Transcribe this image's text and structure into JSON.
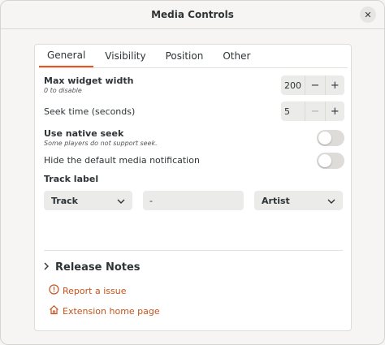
{
  "window": {
    "title": "Media Controls"
  },
  "tabs": [
    {
      "label": "General",
      "active": true
    },
    {
      "label": "Visibility"
    },
    {
      "label": "Position"
    },
    {
      "label": "Other"
    }
  ],
  "settings": {
    "max_widget_width": {
      "label": "Max widget width",
      "subtitle": "0 to disable",
      "value": "200",
      "minus": "−",
      "plus": "+"
    },
    "seek_time": {
      "label": "Seek time (seconds)",
      "value": "5",
      "minus": "−",
      "plus": "+"
    },
    "native_seek": {
      "label": "Use native seek",
      "subtitle": "Some players do not support seek."
    },
    "hide_notification": {
      "label": "Hide the default media notification"
    },
    "track_label": {
      "label": "Track label",
      "first": "Track",
      "separator": "-",
      "last": "Artist"
    }
  },
  "release_notes": {
    "label": "Release Notes"
  },
  "links": {
    "report": "Report a issue",
    "home": "Extension home page"
  },
  "colors": {
    "accent": "#e95420",
    "link": "#c7521c"
  }
}
